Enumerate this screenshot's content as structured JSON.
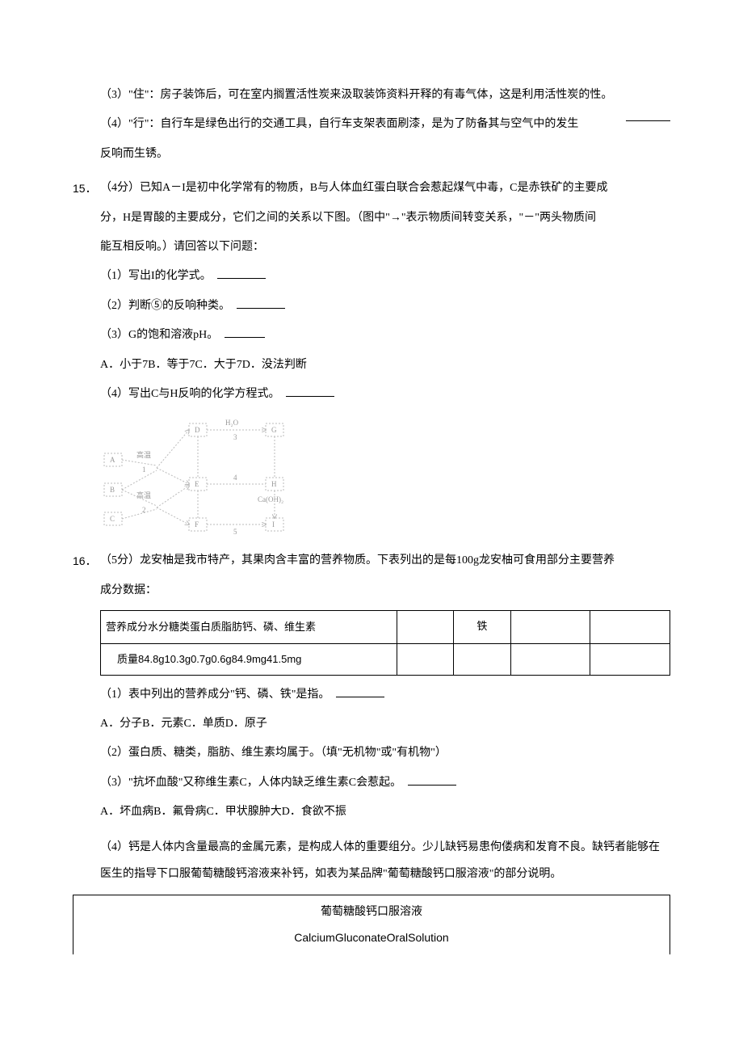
{
  "q14": {
    "p3": "（3）\"住\"：房子装饰后，可在室内搁置活性炭来汲取装饰资料开释的有毒气体，这是利用活性炭的性。",
    "p4a": "（4）\"行\"：自行车是绿色出行的交通工具，自行车支架表面刷漆，是为了防备其与空气中的发生",
    "p4b": "反响而生锈。"
  },
  "q15": {
    "num": "15．",
    "stem1": "（4分）已知A－I是初中化学常有的物质，B与人体血红蛋白联合会惹起煤气中毒，C是赤铁矿的主要成",
    "stem2": "分，H是胃酸的主要成分，它们之间的关系以下图。（图中\"→\"表示物质间转变关系，\"－\"两头物质间",
    "stem3": "能互相反响。）请回答以下问题：",
    "s1": "（1）写出I的化学式。",
    "s2": "（2）判断⑤的反响种类。",
    "s3": "（3）G的饱和溶液pH。",
    "opts": "A．小于7B．等于7C．大于7D．没法判断",
    "s4": "（4）写出C与H反响的化学方程式。",
    "diagram": {
      "nodes": {
        "A": "A",
        "B": "B",
        "C": "C",
        "D": "D",
        "E": "E",
        "F": "F",
        "G": "G",
        "H": "H",
        "I": "I"
      },
      "labels": {
        "ht": "高温",
        "h2o": "H₂O",
        "caoh": "Ca(OH)₂",
        "n1": "1",
        "n2": "2",
        "n3": "3",
        "n4": "4",
        "n5": "5"
      }
    }
  },
  "q16": {
    "num": "16．",
    "stem1": "（5分）龙安柚是我市特产，其果肉含丰富的营养物质。下表列出的是每100g龙安柚可食用部分主要营养",
    "stem2": "成分数据：",
    "table": {
      "r1c1": "营养成分水分糖类蛋白质脂肪钙、磷、维生素",
      "r1c3": "铁",
      "r2c1": "质量84.8g10.3g0.7g0.6g84.9mg41.5mg"
    },
    "s1": "（1）表中列出的营养成分\"钙、磷、铁\"是指。",
    "opts1": "A．分子B．元素C．单质D．原子",
    "s2": "（2）蛋白质、糖类，脂肪、维生素均属于。（填\"无机物\"或\"有机物\"）",
    "s3": "（3）\"抗坏血酸\"又称维生素C，人体内缺乏维生素C会惹起。",
    "opts3": "A．坏血病B．氟骨病C．甲状腺肿大D．食欲不振",
    "s4": "（4）钙是人体内含量最高的金属元素，是构成人体的重要组分。少儿缺钙易患佝偻病和发育不良。缺钙者能够在医生的指导下口服葡萄糖酸钙溶液来补钙，如表为某品牌\"葡萄糖酸钙口服溶液\"的部分说明。",
    "box": {
      "line1": "葡萄糖酸钙口服溶液",
      "line2": "CalciumGluconateOralSolution"
    }
  }
}
